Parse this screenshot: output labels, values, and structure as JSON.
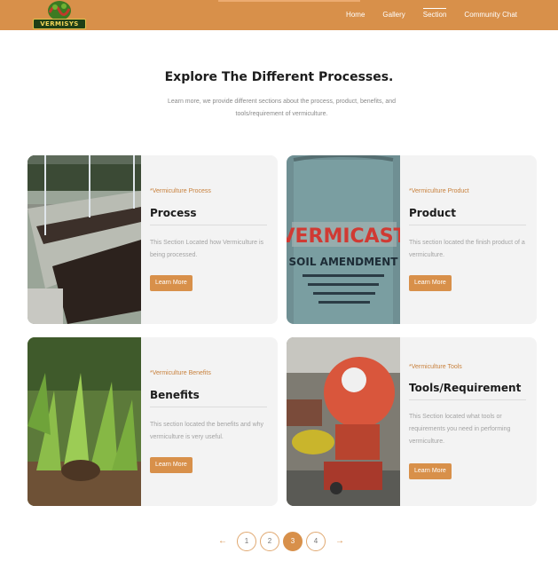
{
  "header": {
    "logo_text": "VERMISYS",
    "nav": [
      "Home",
      "Gallery",
      "Section",
      "Community Chat"
    ],
    "active_nav": "Section"
  },
  "intro": {
    "title": "Explore The Different Processes.",
    "subtitle": "Learn more, we provide different sections about the process, product, benefits, and tools/requirement of vermiculture."
  },
  "cards": [
    {
      "tag": "*Vermiculture Process",
      "title": "Process",
      "desc": "This Section Located how Vermiculture is being processed.",
      "button": "Learn More",
      "image": "greenhouse-beds-photo"
    },
    {
      "tag": "*Vermiculture Product",
      "title": "Product",
      "desc": "This section located the finish product of a vermiculture.",
      "button": "Learn More",
      "image": "vermicast-sack-photo"
    },
    {
      "tag": "*Vermiculture Benefits",
      "title": "Benefits",
      "desc": "This section located the benefits and why vermiculture is very useful.",
      "button": "Learn More",
      "image": "plants-photo"
    },
    {
      "tag": "*Vermiculture Tools",
      "title": "Tools/Requirement",
      "desc": "This Section located what tools or requirements you need in performing vermiculture.",
      "button": "Learn More",
      "image": "shredder-machine-photo"
    }
  ],
  "pagination": {
    "prev": "←",
    "pages": [
      "1",
      "2",
      "3",
      "4"
    ],
    "current": "3",
    "next": "→"
  },
  "colors": {
    "accent": "#d8904a",
    "card_bg": "#f3f3f3",
    "text": "#1d1d1d"
  }
}
